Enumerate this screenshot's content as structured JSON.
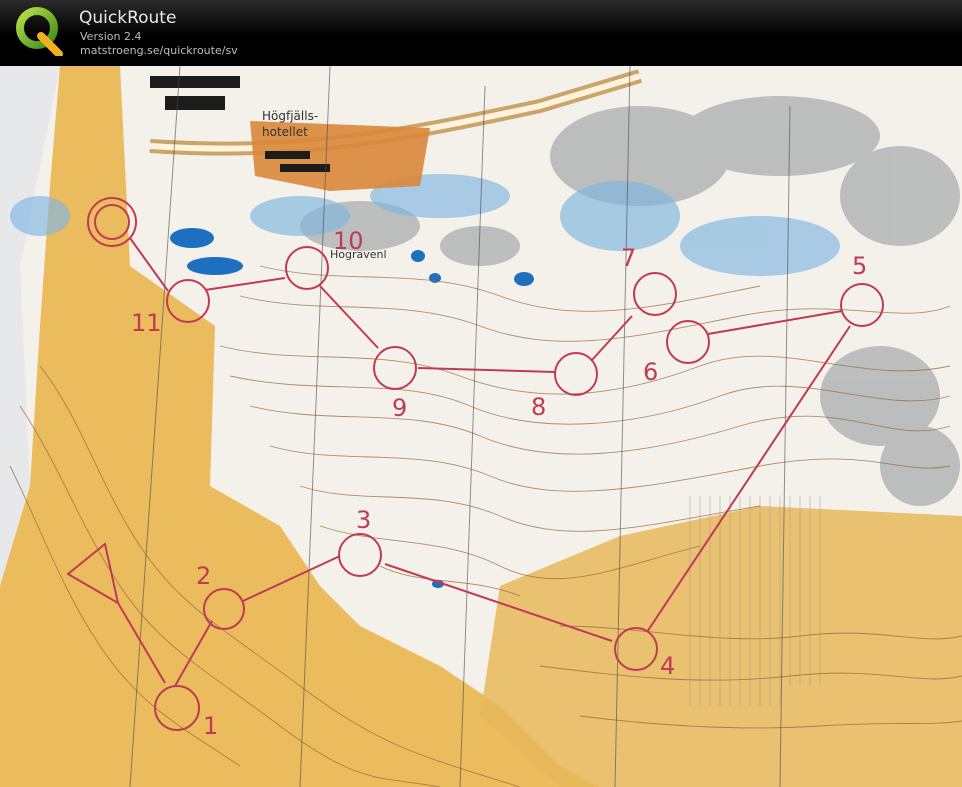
{
  "header": {
    "title": "QuickRoute",
    "version": "Version 2.4",
    "url": "matstroeng.se/quickroute/sv",
    "logo_letter": "Q"
  },
  "map": {
    "labels": {
      "hotel": "Högfjälls-\nhotellet",
      "lake": "Hogravenl"
    },
    "course_color": "#c03a55",
    "controls": [
      {
        "label": "1"
      },
      {
        "label": "2"
      },
      {
        "label": "3"
      },
      {
        "label": "4"
      },
      {
        "label": "5"
      },
      {
        "label": "6"
      },
      {
        "label": "7"
      },
      {
        "label": "8"
      },
      {
        "label": "9"
      },
      {
        "label": "10"
      },
      {
        "label": "11"
      }
    ]
  }
}
